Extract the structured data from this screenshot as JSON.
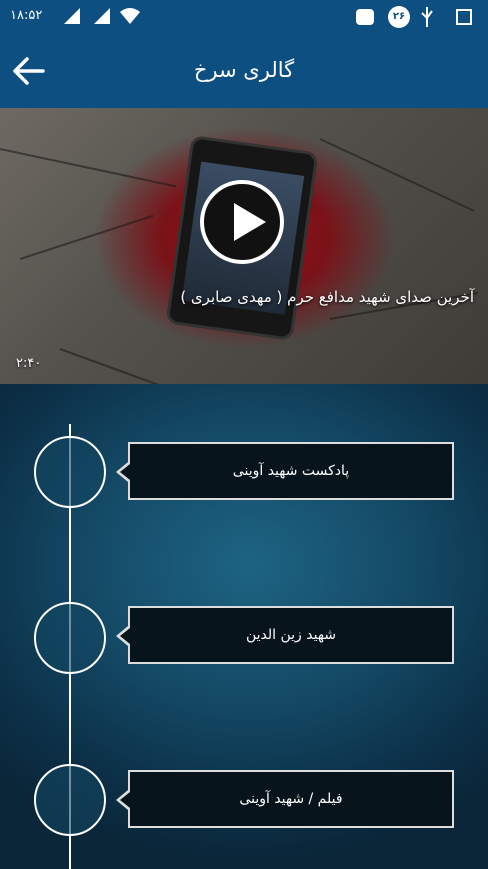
{
  "status_bar": {
    "time": "۱۸:۵۲",
    "badge": "۲۶"
  },
  "app_bar": {
    "title": "گالری سرخ"
  },
  "video": {
    "title": "آخرین صدای شهید مدافع حرم ( مهدی صابری )",
    "duration": "۲:۴۰"
  },
  "timeline": {
    "items": [
      {
        "label": "پادکست شهید آوینی"
      },
      {
        "label": "شهید زین الدین"
      },
      {
        "label": "فیلم / شهید آوینی"
      }
    ]
  }
}
